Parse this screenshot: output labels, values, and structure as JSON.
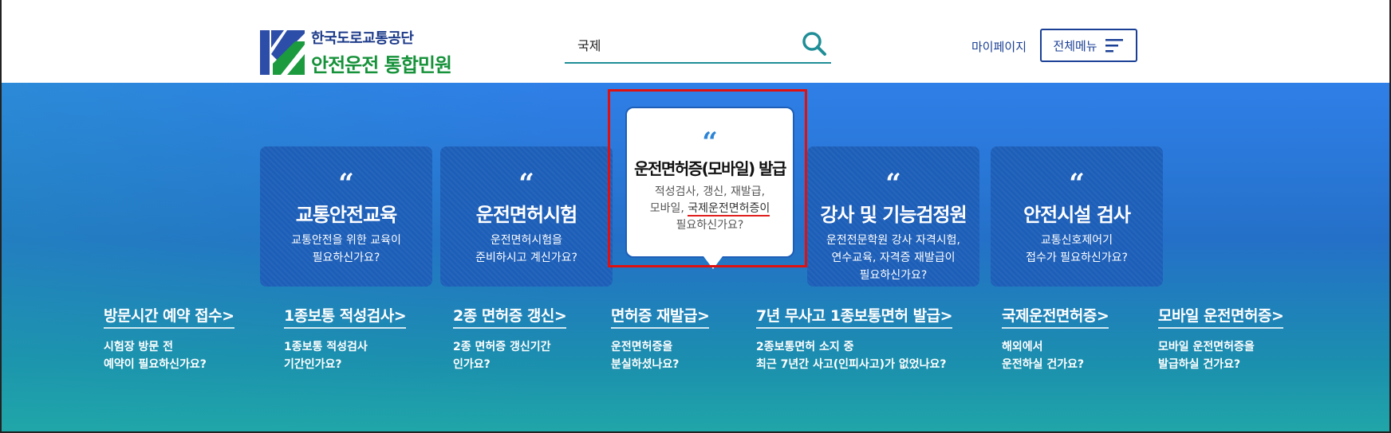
{
  "header": {
    "logo_line1": "한국도로교통공단",
    "logo_line2": "안전운전 통합민원",
    "search_value": "국제",
    "mypage_label": "마이페이지",
    "allmenu_label": "전체메뉴"
  },
  "colors": {
    "brand_blue": "#1a3f95",
    "brand_green": "#16923a",
    "hero_blue": "#2f7fe8",
    "card_blue": "#1d5fb8",
    "highlight_red": "#e01010"
  },
  "cards": [
    {
      "quote": "“",
      "title": "교통안전교육",
      "desc1": "교통안전을 위한 교육이",
      "desc2": "필요하신가요?",
      "desc3": ""
    },
    {
      "quote": "“",
      "title": "운전면허시험",
      "desc1": "운전면허시험을",
      "desc2": "준비하시고 계신가요?",
      "desc3": ""
    },
    {
      "quote": "“",
      "title": "운전면허증(모바일) 발급",
      "desc1": "적성검사, 갱신, 재발급,",
      "desc2_pre": "모바일, ",
      "desc2_hl": "국제운전면허증이",
      "desc3": "필요하신가요?"
    },
    {
      "quote": "“",
      "title": "강사 및 기능검정원",
      "desc1": "운전전문학원 강사 자격시험,",
      "desc2": "연수교육, 자격증 재발급이",
      "desc3": "필요하신가요?"
    },
    {
      "quote": "“",
      "title": "안전시설 검사",
      "desc1": "교통신호제어기",
      "desc2": "접수가 필요하신가요?",
      "desc3": ""
    }
  ],
  "quick_links": [
    {
      "title": "방문시간 예약 접수",
      "desc1": "시험장 방문 전",
      "desc2": "예약이 필요하신가요?"
    },
    {
      "title": "1종보통 적성검사",
      "desc1": "1종보통 적성검사",
      "desc2": "기간인가요?"
    },
    {
      "title": "2종 면허증 갱신",
      "desc1": "2종 면허증 갱신기간",
      "desc2": "인가요?"
    },
    {
      "title": "면허증 재발급",
      "desc1": "운전면허증을",
      "desc2": "분실하셨나요?"
    },
    {
      "title": "7년 무사고 1종보통면허 발급",
      "desc1": "2종보통면허 소지 중",
      "desc2": "최근 7년간 사고(인피사고)가 없었나요?"
    },
    {
      "title": "국제운전면허증",
      "desc1": "해외에서",
      "desc2": "운전하실 건가요?"
    },
    {
      "title": "모바일 운전면허증",
      "desc1": "모바일 운전면허증을",
      "desc2": "발급하실 건가요?"
    }
  ],
  "link_arrow": ">"
}
